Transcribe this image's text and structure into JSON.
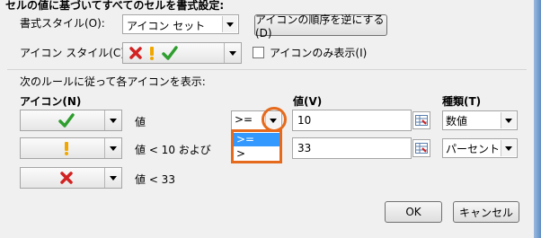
{
  "header": {
    "title": "セルの値に基づいてすべてのセルを書式設定:"
  },
  "format_style": {
    "label": "書式スタイル(O):",
    "value": "アイコン セット"
  },
  "reverse_button": {
    "label": "アイコンの順序を逆にする(D)"
  },
  "icon_style": {
    "label": "アイコン スタイル(C):"
  },
  "icon_only": {
    "label": "アイコンのみ表示(I)",
    "checked": false
  },
  "rules": {
    "instruction": "次のルールに従って各アイコンを表示:",
    "col_icon": "アイコン(N)",
    "col_value": "値(V)",
    "col_type": "種類(T)",
    "rows": [
      {
        "icon": "green-check-icon",
        "condition": "値",
        "operator": ">=",
        "value": "10",
        "type": "数値"
      },
      {
        "icon": "yellow-exclamation-icon",
        "condition": "値 < 10 および",
        "operator": "",
        "value": "33",
        "type": "パーセント"
      },
      {
        "icon": "red-x-icon",
        "condition": "値 < 33",
        "operator": "",
        "value": "",
        "type": ""
      }
    ]
  },
  "operator_dropdown": {
    "options": [
      ">=",
      ">"
    ],
    "selected": ">="
  },
  "buttons": {
    "ok": "OK",
    "cancel": "キャンセル"
  },
  "colors": {
    "green": "#2e9e2e",
    "yellow": "#f0a800",
    "red": "#d22222",
    "highlight": "#e66a1c",
    "selection": "#3399ff"
  }
}
